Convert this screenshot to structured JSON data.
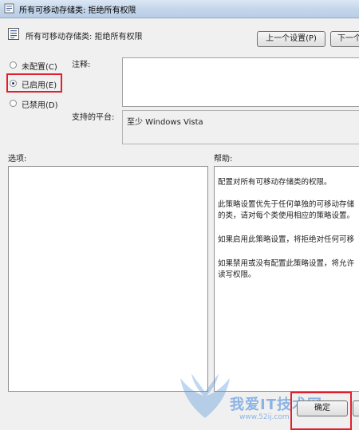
{
  "window": {
    "title": "所有可移动存储类: 拒绝所有权限"
  },
  "header": {
    "title": "所有可移动存储类: 拒绝所有权限",
    "prev_button": "上一个设置(P)",
    "next_button": "下一个"
  },
  "state_options": [
    {
      "label": "未配置(C)",
      "checked": false
    },
    {
      "label": "已启用(E)",
      "checked": true
    },
    {
      "label": "已禁用(D)",
      "checked": false
    }
  ],
  "comment": {
    "label": "注释:",
    "value": ""
  },
  "platform": {
    "label": "支持的平台:",
    "value": "至少 Windows Vista"
  },
  "options": {
    "label": "选项:"
  },
  "help": {
    "label": "帮助:",
    "lines": [
      "配置对所有可移动存储类的权限。",
      "此策略设置优先于任何单独的可移动存储",
      "的类，请对每个类使用相应的策略设置。",
      "如果启用此策略设置，将拒绝对任何可移",
      "如果禁用或没有配置此策略设置，将允许",
      "读写权限。"
    ]
  },
  "buttons": {
    "ok": "确定",
    "cancel": ""
  },
  "watermark": {
    "text": "我爱IT技术网",
    "url": "www.52ij.com"
  },
  "colors": {
    "highlight": "#e0202e",
    "window_bg": "#f0f0f0",
    "titlebar": "#c3d5ea"
  }
}
